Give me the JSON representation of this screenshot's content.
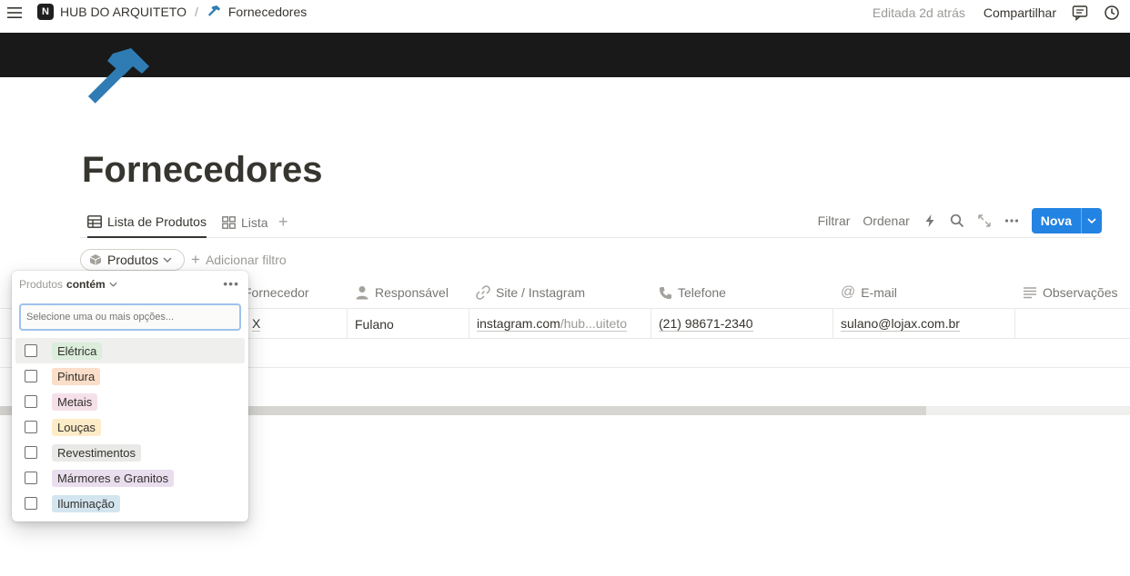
{
  "breadcrumb": {
    "workspace": "HUB DO ARQUITETO",
    "separator": "/",
    "page": "Fornecedores"
  },
  "topbar": {
    "edited": "Editada 2d atrás",
    "share": "Compartilhar"
  },
  "page": {
    "title": "Fornecedores"
  },
  "views": [
    {
      "label": "Lista de Produtos"
    },
    {
      "label": "Lista"
    }
  ],
  "toolbar": {
    "filter": "Filtrar",
    "sort": "Ordenar",
    "new": "Nova"
  },
  "filter": {
    "chip": "Produtos",
    "add": "Adicionar filtro"
  },
  "table": {
    "columns": [
      "Fornecedor",
      "Responsável",
      "Site / Instagram",
      "Telefone",
      "E-mail",
      "Observações"
    ],
    "row": {
      "fornecedor": "X",
      "responsavel": "Fulano",
      "site_main": "instagram.com",
      "site_rest": "/hub...uiteto",
      "telefone": "(21) 98671-2340",
      "email": "sulano@lojax.com.br"
    }
  },
  "popup": {
    "property": "Produtos",
    "operator": "contém",
    "placeholder": "Selecione uma ou mais opções...",
    "options": [
      {
        "label": "Elétrica",
        "color": "#dbeddb"
      },
      {
        "label": "Pintura",
        "color": "#fadec9"
      },
      {
        "label": "Metais",
        "color": "#f5e0e9"
      },
      {
        "label": "Louças",
        "color": "#fdecc8"
      },
      {
        "label": "Revestimentos",
        "color": "#e9e9e7"
      },
      {
        "label": "Mármores e Granitos",
        "color": "#e8deee"
      },
      {
        "label": "Iluminação",
        "color": "#d3e5ef"
      }
    ]
  },
  "colors": {
    "accent": "#2383e2",
    "cover": "#191919",
    "hammer": "#2e7cb3"
  }
}
